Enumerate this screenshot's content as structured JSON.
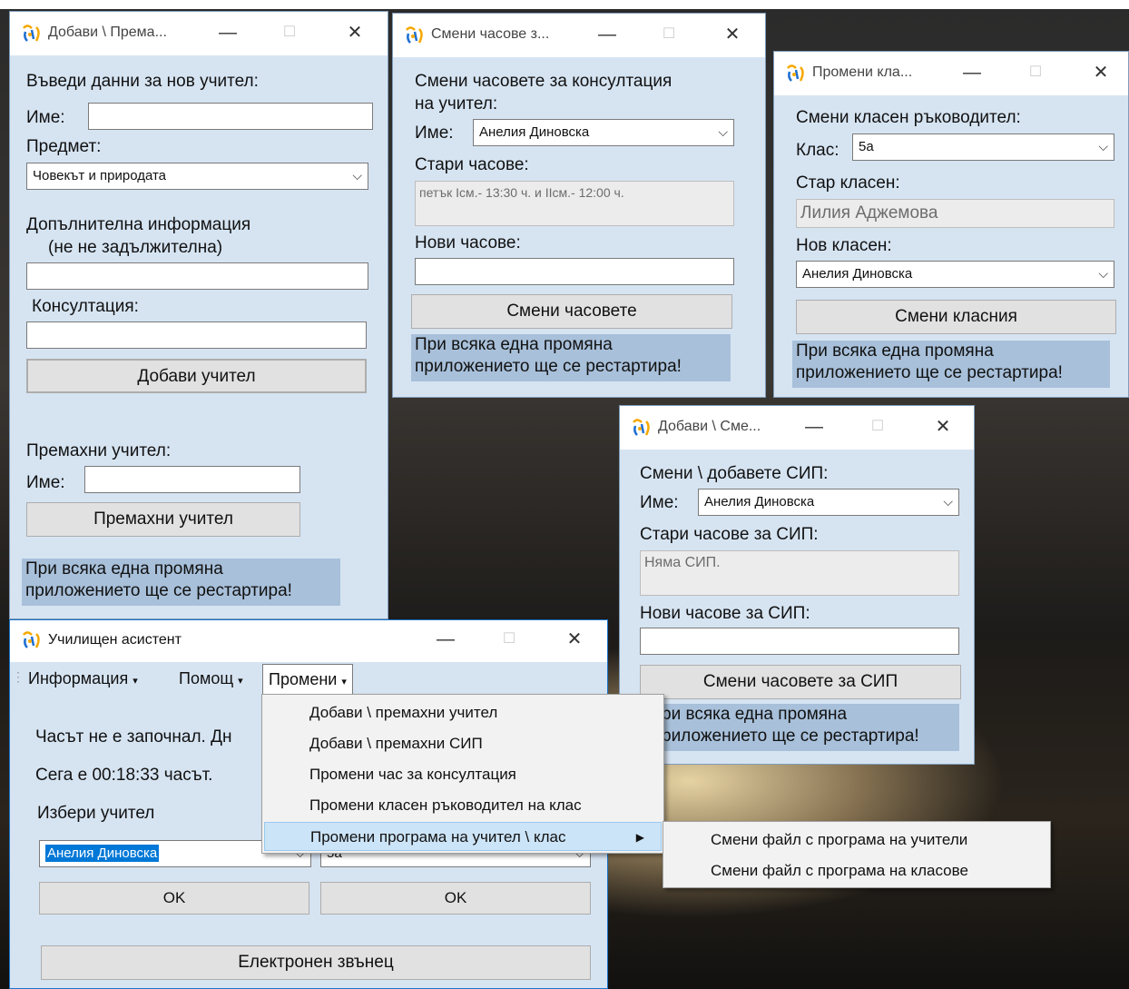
{
  "icons": {
    "app": "school-assistant-icon"
  },
  "win_teacher": {
    "title": "Добави \\ Према...",
    "add_heading": "Въведи данни за нов учител:",
    "name_label": "Име:",
    "subject_label": "Предмет:",
    "subject_value": "Човекът и природата",
    "extra_label_1": "Допълнителна информация",
    "extra_label_2": "(не не задължителна)",
    "consult_label": "Консултация:",
    "add_button": "Добави учител",
    "remove_heading": "Премахни учител:",
    "remove_name_label": "Име:",
    "remove_button": "Премахни учител",
    "note_1": "При всяка една промяна",
    "note_2": "приложението ще се рестартира!"
  },
  "win_hours": {
    "title": "Смени часове з...",
    "heading_1": "Смени часовете за консултация",
    "heading_2": "на учител:",
    "name_label": "Име:",
    "name_value": "Анелия Диновска",
    "old_label": "Стари часове:",
    "old_value": "петък Iсм.- 13:30 ч. и IIсм.- 12:00 ч.",
    "new_label": "Нови часове:",
    "button": "Смени часовете",
    "note_1": "При всяка една промяна",
    "note_2": "приложението ще се рестартира!"
  },
  "win_class": {
    "title": "Промени кла...",
    "heading": "Смени класен ръководител:",
    "class_label": "Клас:",
    "class_value": "5а",
    "old_label": "Стар класен:",
    "old_value": "Лилия Аджемова",
    "new_label": "Нов класен:",
    "new_value": "Анелия Диновска",
    "button": "Смени класния",
    "note_1": "При всяка една промяна",
    "note_2": "приложението ще се рестартира!"
  },
  "win_sip": {
    "title": "Добави \\ Сме...",
    "heading": "Смени \\ добавете СИП:",
    "name_label": "Име:",
    "name_value": "Анелия Диновска",
    "old_label": "Стари часове за СИП:",
    "old_value": "Няма СИП.",
    "new_label": "Нови часове за СИП:",
    "button": "Смени часовете за СИП",
    "note_1": "ри всяка една промяна",
    "note_2": "риложението ще се рестартира!"
  },
  "win_main": {
    "title": "Училищен асистент",
    "menubar": [
      "Информация",
      "Помощ",
      "Промени"
    ],
    "status_1": "Часът не е започнал. Дн",
    "status_2": "Сега е 00:18:33 часът.",
    "choose_label": "Избери учител",
    "teacher_value": "Анелия Диновска",
    "class_value": "5а",
    "ok_1": "OK",
    "ok_2": "OK",
    "bell_button": "Електронен звънец"
  },
  "menu_change": {
    "items": [
      "Добави \\ премахни учител",
      "Добави \\ премахни СИП",
      "Промени час за консултация",
      "Промени класен ръководител на клас",
      "Промени програма на учител \\ клас"
    ]
  },
  "submenu_schedule": {
    "items": [
      "Смени файл с програма на учители",
      "Смени файл с програма на класове"
    ]
  },
  "colors": {
    "window_bg": "#d6e4f2",
    "note_bg": "#a8c0da",
    "highlight": "#cce4f7",
    "selection": "#0078d7"
  }
}
